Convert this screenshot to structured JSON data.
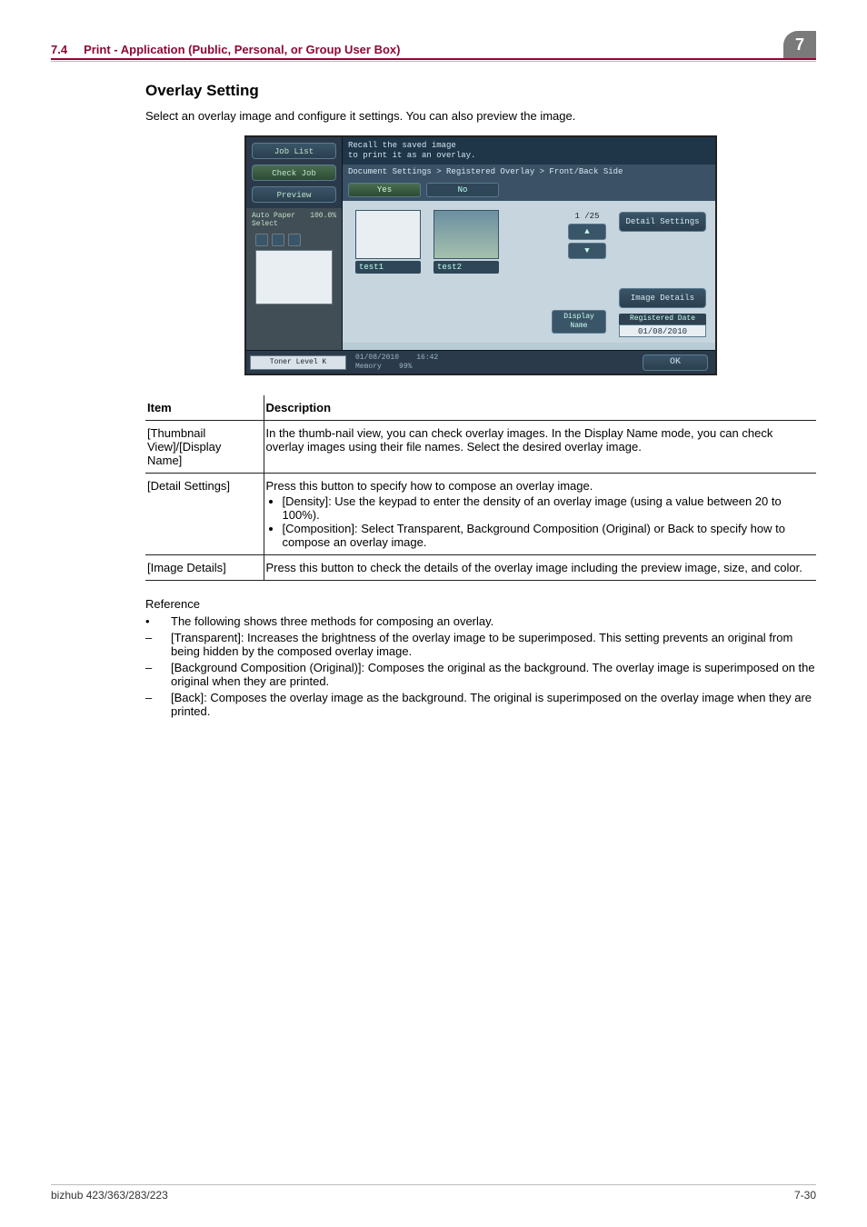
{
  "header": {
    "section_no": "7.4",
    "section_title": "Print - Application (Public, Personal, or Group User Box)",
    "chapter_badge": "7"
  },
  "heading": "Overlay Setting",
  "intro": "Select an overlay image and configure it settings. You can also preview the image.",
  "device": {
    "left": {
      "job_list": "Job List",
      "check_job": "Check Job",
      "preview": "Preview",
      "auto_paper": "Auto Paper Select",
      "auto_paper_pct": "100.0%"
    },
    "header_line": "Recall the saved image\nto print it as an overlay.",
    "breadcrumb": "Document Settings > Registered Overlay > Front/Back Side",
    "tab_yes": "Yes",
    "tab_no": "No",
    "thumb1": "test1",
    "thumb2": "test2",
    "page_counter": "1  /25",
    "detail_settings": "Detail Settings",
    "image_details": "Image Details",
    "display_name": "Display\nName",
    "registered_label": "Registered Date",
    "registered_value": "01/08/2010",
    "toner": "Toner Level  K",
    "foot_date": "01/08/2010",
    "foot_time": "16:42",
    "foot_mem_label": "Memory",
    "foot_mem_val": "99%",
    "ok": "OK"
  },
  "table": {
    "col_item": "Item",
    "col_desc": "Description",
    "rows": [
      {
        "item": "[Thumbnail View]/[Display Name]",
        "desc": "In the thumb-nail view, you can check overlay images. In the Display Name mode, you can check overlay images using their file names. Select the desired overlay image."
      },
      {
        "item": "[Detail Settings]",
        "desc_lead": "Press this button to specify how to compose an overlay image.",
        "bullets": [
          "[Density]: Use the keypad to enter the density of an overlay image (using a value between 20 to 100%).",
          "[Composition]: Select Transparent, Background Composition (Original) or Back to specify how to compose an overlay image."
        ]
      },
      {
        "item": "[Image Details]",
        "desc": "Press this button to check the details of the overlay image including the preview image, size, and color."
      }
    ]
  },
  "reference": {
    "label": "Reference",
    "items": [
      {
        "bullet": "•",
        "text": "The following shows three methods for composing an overlay."
      },
      {
        "bullet": "–",
        "text": "[Transparent]: Increases the brightness of the overlay image to be superimposed. This setting prevents an original from being hidden by the composed overlay image."
      },
      {
        "bullet": "–",
        "text": "[Background Composition (Original)]: Composes the original as the background. The overlay image is superimposed on the original when they are printed."
      },
      {
        "bullet": "–",
        "text": "[Back]: Composes the overlay image as the background. The original is superimposed on the overlay image when they are printed."
      }
    ]
  },
  "footer": {
    "left": "bizhub 423/363/283/223",
    "right": "7-30"
  }
}
